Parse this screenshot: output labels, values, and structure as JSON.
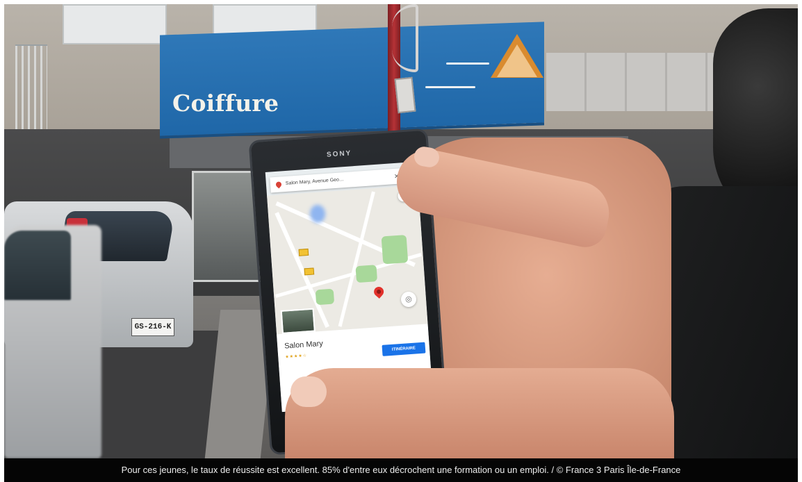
{
  "photo": {
    "storefront_sign": "Coiffure",
    "phone_brand": "SONY",
    "car_plate": "GS-216-K"
  },
  "maps_app": {
    "search_text": "Salon Mary, Avenue Geo…",
    "place_name": "Salon Mary",
    "rating_stars": "★★★★☆",
    "route_button": "ITINÉRAIRE"
  },
  "caption": "Pour ces jeunes, le taux de réussite est excellent. 85% d'entre eux décrochent une formation ou un emploi. / © France 3 Paris Île-de-France",
  "colors": {
    "awning_blue": "#2a70b0",
    "caption_bg": "#050505",
    "caption_text": "#ededed",
    "map_pin": "#e2312b",
    "route_button": "#1a73e8"
  }
}
